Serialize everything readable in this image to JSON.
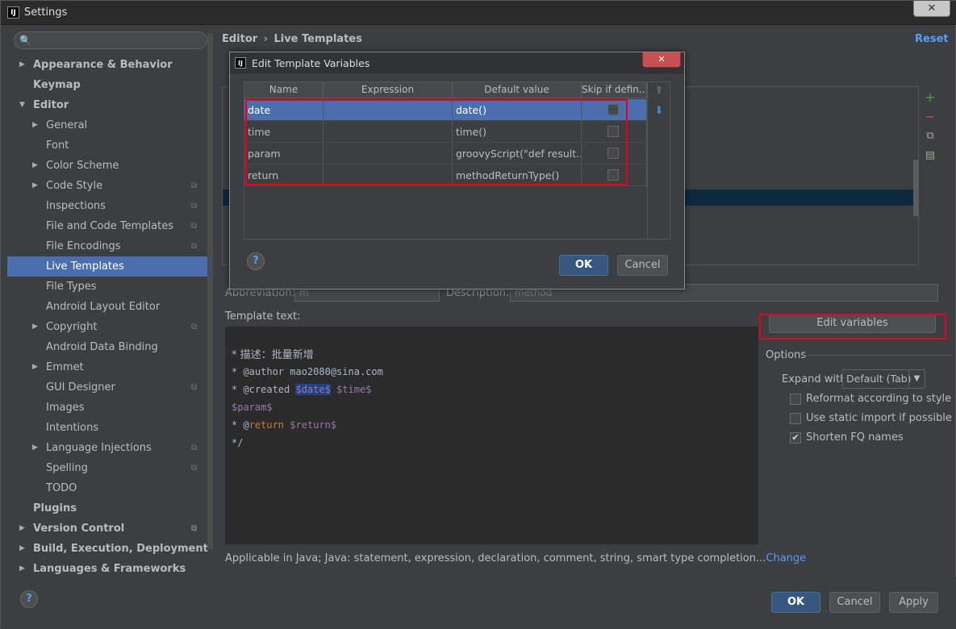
{
  "window": {
    "title": "Settings",
    "app_icon": "IJ"
  },
  "search": {
    "placeholder": ""
  },
  "sidebar": {
    "items": [
      {
        "label": "Appearance & Behavior",
        "bold": true,
        "arrow": "right",
        "level": 0
      },
      {
        "label": "Keymap",
        "bold": true,
        "arrow": "",
        "level": 0
      },
      {
        "label": "Editor",
        "bold": true,
        "arrow": "down",
        "level": 0
      },
      {
        "label": "General",
        "arrow": "right",
        "level": 1
      },
      {
        "label": "Font",
        "arrow": "",
        "level": 1
      },
      {
        "label": "Color Scheme",
        "arrow": "right",
        "level": 1
      },
      {
        "label": "Code Style",
        "arrow": "right",
        "level": 1,
        "project": true
      },
      {
        "label": "Inspections",
        "arrow": "",
        "level": 1,
        "project": true
      },
      {
        "label": "File and Code Templates",
        "arrow": "",
        "level": 1,
        "project": true
      },
      {
        "label": "File Encodings",
        "arrow": "",
        "level": 1,
        "project": true
      },
      {
        "label": "Live Templates",
        "arrow": "",
        "level": 1,
        "selected": true
      },
      {
        "label": "File Types",
        "arrow": "",
        "level": 1
      },
      {
        "label": "Android Layout Editor",
        "arrow": "",
        "level": 1
      },
      {
        "label": "Copyright",
        "arrow": "right",
        "level": 1,
        "project": true
      },
      {
        "label": "Android Data Binding",
        "arrow": "",
        "level": 1
      },
      {
        "label": "Emmet",
        "arrow": "right",
        "level": 1
      },
      {
        "label": "GUI Designer",
        "arrow": "",
        "level": 1,
        "project": true
      },
      {
        "label": "Images",
        "arrow": "",
        "level": 1
      },
      {
        "label": "Intentions",
        "arrow": "",
        "level": 1
      },
      {
        "label": "Language Injections",
        "arrow": "right",
        "level": 1,
        "project": true
      },
      {
        "label": "Spelling",
        "arrow": "",
        "level": 1,
        "project": true
      },
      {
        "label": "TODO",
        "arrow": "",
        "level": 1
      },
      {
        "label": "Plugins",
        "bold": true,
        "arrow": "",
        "level": 0
      },
      {
        "label": "Version Control",
        "bold": true,
        "arrow": "right",
        "level": 0,
        "project": true
      },
      {
        "label": "Build, Execution, Deployment",
        "bold": true,
        "arrow": "right",
        "level": 0
      },
      {
        "label": "Languages & Frameworks",
        "bold": true,
        "arrow": "right",
        "level": 0
      }
    ]
  },
  "main": {
    "breadcrumb_root": "Editor",
    "breadcrumb_sep": "›",
    "breadcrumb_page": "Live Templates",
    "reset_label": "Reset",
    "abbreviation_label": "Abbreviation:",
    "abbreviation_value": "m",
    "description_label": "Description:",
    "description_value": "method",
    "template_text_label": "Template text:",
    "edit_variables_label": "Edit variables",
    "options_label": "Options",
    "expand_with_label": "Expand with",
    "expand_with_value": "Default (Tab)",
    "reformat_label": "Reformat according to style",
    "static_import_label": "Use static import if possible",
    "shorten_fq_label": "Shorten FQ names",
    "applicable_text": "Applicable in Java; Java: statement, expression, declaration, comment, string, smart type completion...",
    "change_link": "Change"
  },
  "template_code": {
    "line1": "* 描述：批量新增",
    "line2": "* @author mao2080@sina.com",
    "line3_prefix": "* @created ",
    "line3_date": "$date$",
    "line3_time": "$time$",
    "line4": "$param$",
    "line5_prefix": "* @",
    "line5_keyword": "return",
    "line5_var": "$return$",
    "line6": "*/"
  },
  "dialog": {
    "title": "Edit Template Variables",
    "columns": [
      "Name",
      "Expression",
      "Default value",
      "Skip if defin..."
    ],
    "rows": [
      {
        "name": "date",
        "expression": "",
        "default": "date()",
        "skip": false
      },
      {
        "name": "time",
        "expression": "",
        "default": "time()",
        "skip": false
      },
      {
        "name": "param",
        "expression": "",
        "default": "groovyScript(\"def result...",
        "skip": false
      },
      {
        "name": "return",
        "expression": "",
        "default": "methodReturnType()",
        "skip": false
      }
    ],
    "ok_label": "OK",
    "cancel_label": "Cancel",
    "help_label": "?"
  },
  "footer": {
    "ok_label": "OK",
    "cancel_label": "Cancel",
    "apply_label": "Apply",
    "help_label": "?"
  },
  "colors": {
    "accent": "#4b6eaf",
    "link": "#589df6",
    "highlight_box": "#e8001c"
  }
}
